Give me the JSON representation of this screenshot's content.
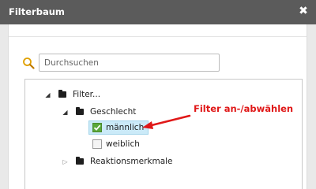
{
  "window": {
    "title": "Filterbaum",
    "close_glyph": "✖"
  },
  "search": {
    "placeholder": "Durchsuchen",
    "value": "",
    "icon": "search-icon"
  },
  "tree": {
    "root": {
      "label": "Filter...",
      "expanded": true
    },
    "group": {
      "label": "Geschlecht",
      "expanded": true
    },
    "items": [
      {
        "label": "männlich",
        "checked": true,
        "selected": true
      },
      {
        "label": "weiblich",
        "checked": false,
        "selected": false
      }
    ],
    "collapsed_group": {
      "label": "Reaktionsmerkmale",
      "expanded": false
    }
  },
  "annotation": {
    "text": "Filter an-/abwählen",
    "color": "#e01818"
  },
  "colors": {
    "titlebar": "#5b5b5b",
    "selection": "#cbeaf8",
    "check_green": "#5aa83a"
  }
}
